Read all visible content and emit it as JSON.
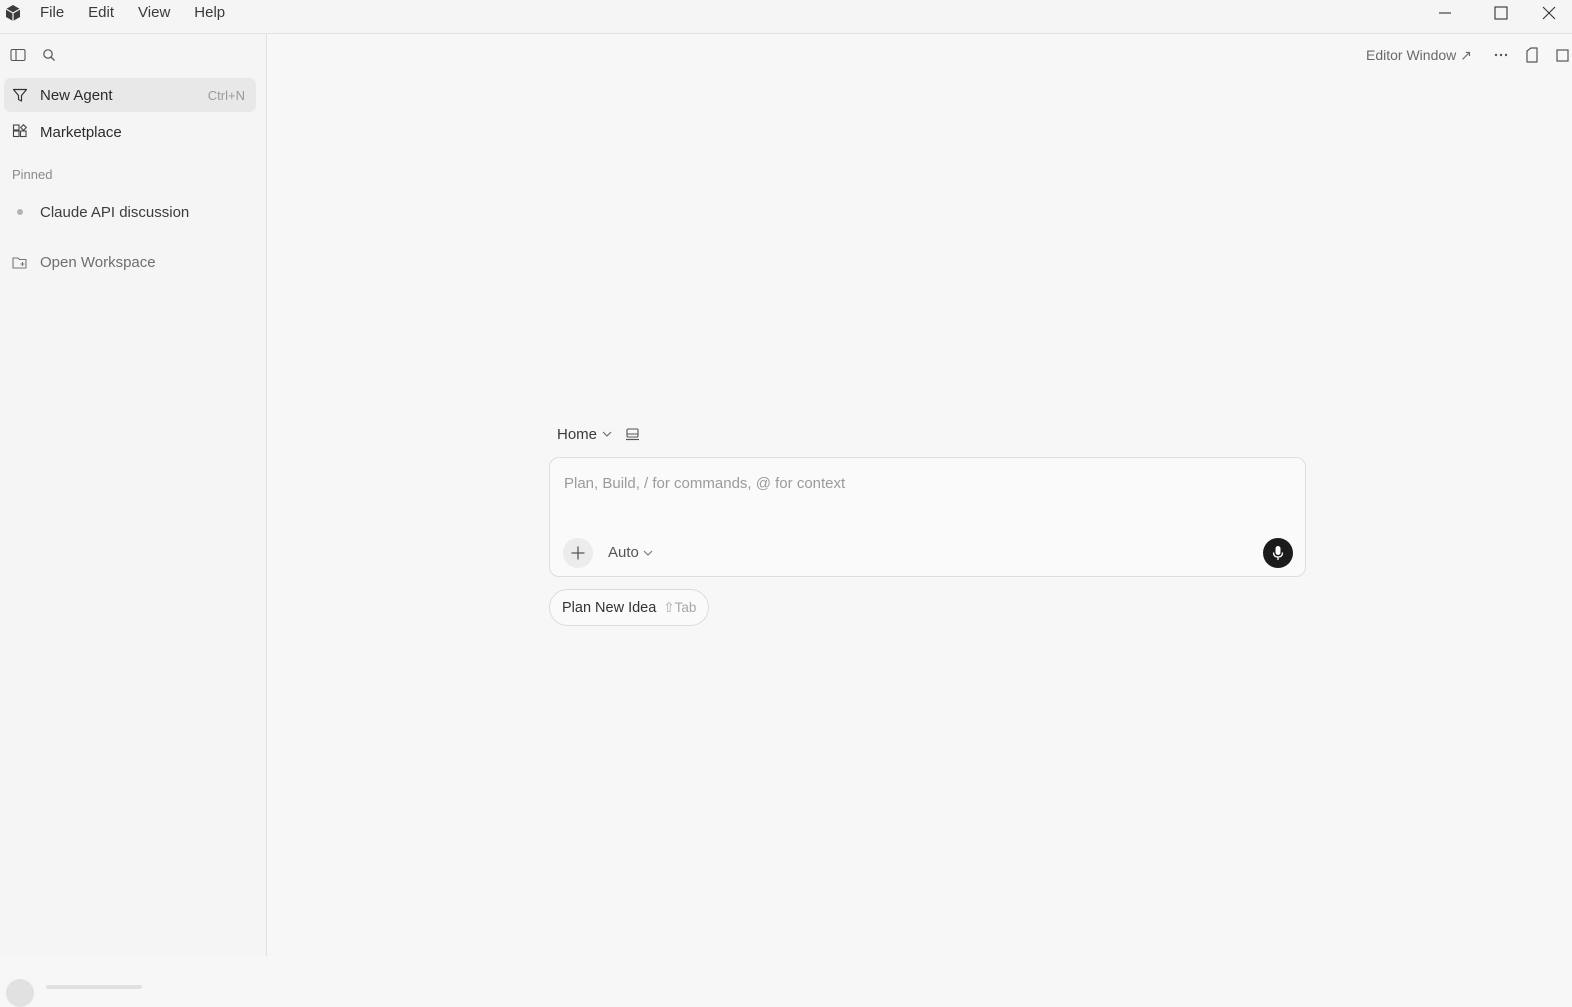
{
  "menu": {
    "file": "File",
    "edit": "Edit",
    "view": "View",
    "help": "Help"
  },
  "window_controls": {
    "minimize": "minimize-icon",
    "maximize": "maximize-icon",
    "close": "close-icon"
  },
  "sidebar": {
    "toggle_icon": "sidebar-toggle-icon",
    "search_icon": "search-icon",
    "items": [
      {
        "label": "New Agent",
        "shortcut": "Ctrl+N",
        "icon": "new-agent-icon",
        "active": true
      },
      {
        "label": "Marketplace",
        "icon": "marketplace-icon"
      }
    ],
    "pinned_title": "Pinned",
    "pinned": [
      {
        "label": "Claude API discussion"
      }
    ],
    "open_workspace": "Open Workspace"
  },
  "header": {
    "editor_window": "Editor Window ↗",
    "more_icon": "more-icon",
    "panel_icon": "panel-icon",
    "layout_icon": "layout-icon"
  },
  "composer": {
    "context": "Home",
    "placeholder": "Plan, Build, / for commands, @ for context",
    "mode": "Auto",
    "add_icon": "plus-icon",
    "mic_icon": "microphone-icon"
  },
  "suggestion": {
    "label": "Plan New Idea",
    "shortcut": "⇧Tab"
  },
  "colors": {
    "background": "#f7f7f7",
    "sidebar": "#f5f5f5",
    "active_item": "#e8e8e8",
    "mic_button": "#1b1b1b"
  }
}
